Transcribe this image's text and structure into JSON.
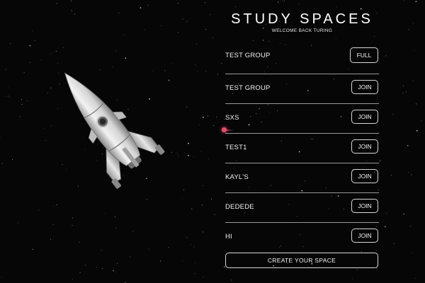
{
  "header": {
    "title": "STUDY SPACES",
    "subtitle": "WELCOME BACK TURING"
  },
  "spaces": [
    {
      "name": "TEST GROUP",
      "action": "FULL"
    },
    {
      "name": "TEST GROUP",
      "action": "JOIN"
    },
    {
      "name": "SXS",
      "action": "JOIN"
    },
    {
      "name": "TEST1",
      "action": "JOIN"
    },
    {
      "name": "KAYL'S",
      "action": "JOIN"
    },
    {
      "name": "DEDEDE",
      "action": "JOIN"
    },
    {
      "name": "HI",
      "action": "JOIN"
    }
  ],
  "create_button": "CREATE YOUR SPACE",
  "theme": {
    "background": "#060606",
    "text": "#ffffff",
    "divider": "#9a9a9a",
    "laser": "#e0506a"
  },
  "icons": {
    "illustration": "rocket-icon",
    "cursor": "laser-pointer-dot"
  }
}
